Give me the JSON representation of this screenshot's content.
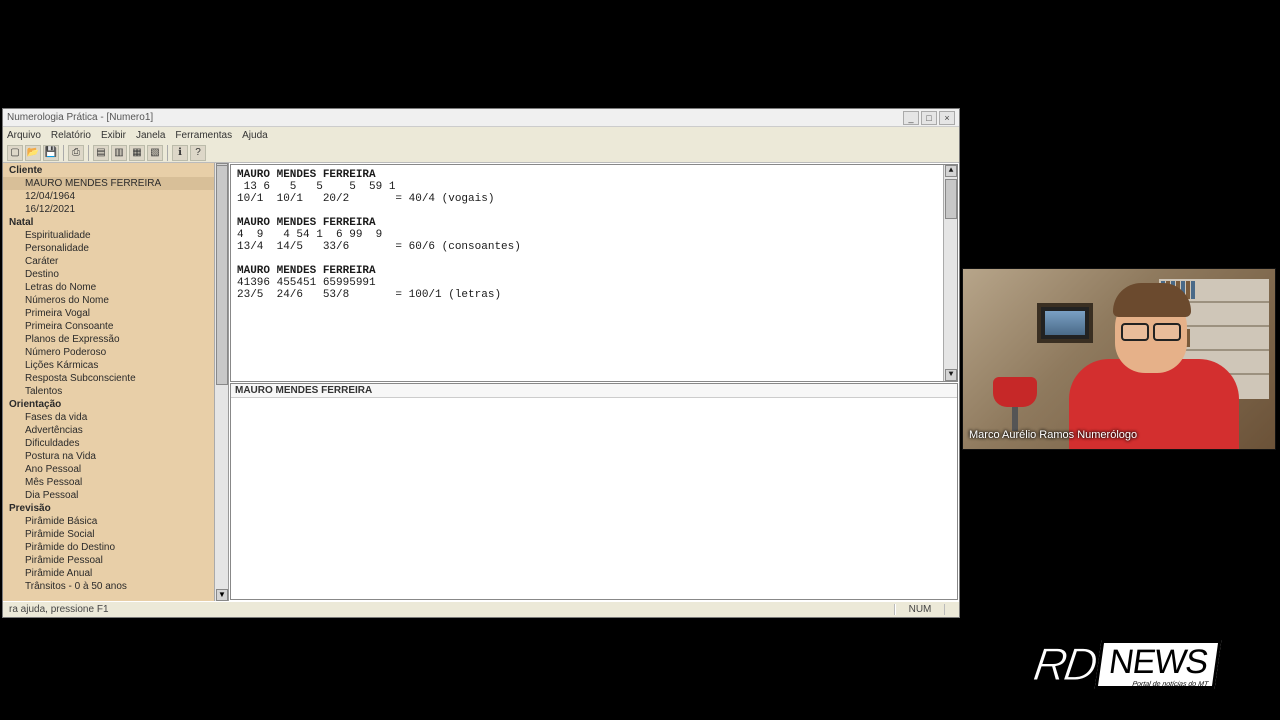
{
  "window": {
    "title": "Numerologia Prática - [Numero1]",
    "btn_min": "_",
    "btn_max": "□",
    "btn_close": "×"
  },
  "menu": [
    "Arquivo",
    "Relatório",
    "Exibir",
    "Janela",
    "Ferramentas",
    "Ajuda"
  ],
  "sidebar": {
    "sections": [
      {
        "label": "Cliente",
        "items": [
          "MAURO MENDES FERREIRA",
          "12/04/1964",
          "16/12/2021"
        ]
      },
      {
        "label": "Natal",
        "items": [
          "Espiritualidade",
          "Personalidade",
          "Caráter",
          "Destino",
          "Letras do Nome",
          "Números do Nome",
          "Primeira Vogal",
          "Primeira Consoante",
          "Planos de Expressão",
          "Número Poderoso",
          "Lições Kármicas",
          "Resposta Subconsciente",
          "Talentos"
        ]
      },
      {
        "label": "Orientação",
        "items": [
          "Fases da vida",
          "Advertências",
          "Dificuldades",
          "Postura na Vida",
          "Ano Pessoal",
          "Mês Pessoal",
          "Dia Pessoal"
        ]
      },
      {
        "label": "Previsão",
        "items": [
          "Pirâmide Básica",
          "Pirâmide Social",
          "Pirâmide do Destino",
          "Pirâmide Pessoal",
          "Pirâmide Anual",
          "Trânsitos -  0 à  50 anos"
        ]
      }
    ]
  },
  "report": {
    "blocks": [
      {
        "title": "MAURO MENDES FERREIRA",
        "row1": " 13 6   5   5    5  59 1",
        "row2": "10/1  10/1   20/2       = 40/4 (vogais)"
      },
      {
        "title": "MAURO MENDES FERREIRA",
        "row1": "4  9   4 54 1  6 99  9",
        "row2": "13/4  14/5   33/6       = 60/6 (consoantes)"
      },
      {
        "title": "MAURO MENDES FERREIRA",
        "row1": "41396 455451 65995991",
        "row2": "23/5  24/6   53/8       = 100/1 (letras)"
      }
    ],
    "bottom_header": "MAURO MENDES FERREIRA"
  },
  "status": {
    "left": "ra ajuda, pressione F1",
    "right": "NUM"
  },
  "webcam": {
    "caption": "Marco Aurélio Ramos Numerólogo"
  },
  "logo": {
    "rd": "RD",
    "news": "NEWS",
    "tag": "Portal de notícias do MT"
  }
}
